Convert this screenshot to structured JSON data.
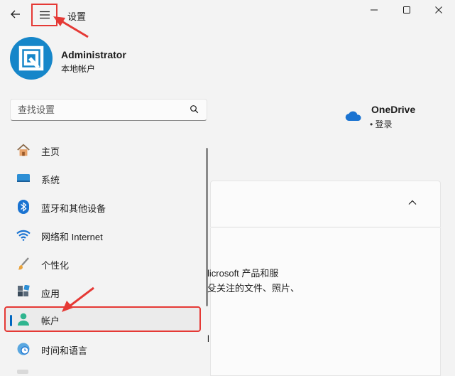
{
  "titlebar": {
    "app_title": "设置",
    "back_icon": "back-arrow-icon",
    "menu_icon": "hamburger-menu-icon",
    "window_controls": [
      "minimize-icon",
      "maximize-icon",
      "close-icon"
    ]
  },
  "user": {
    "name": "Administrator",
    "account_type": "本地帐户"
  },
  "search": {
    "placeholder": "查找设置"
  },
  "nav": {
    "items": [
      {
        "label": "主页",
        "icon": "home-icon"
      },
      {
        "label": "系统",
        "icon": "display-icon"
      },
      {
        "label": "蓝牙和其他设备",
        "icon": "bluetooth-icon"
      },
      {
        "label": "网络和 Internet",
        "icon": "wifi-icon"
      },
      {
        "label": "个性化",
        "icon": "paintbrush-icon"
      },
      {
        "label": "应用",
        "icon": "apps-icon"
      },
      {
        "label": "帐户",
        "icon": "account-icon",
        "selected": true
      },
      {
        "label": "时间和语言",
        "icon": "clock-globe-icon"
      }
    ]
  },
  "onedrive": {
    "title": "OneDrive",
    "status": "• 登录"
  },
  "content": {
    "line1": "licrosoft 产品和服",
    "line2": "殳关注的文件、照片、",
    "fragment": "l"
  },
  "colors": {
    "accent": "#0067c0",
    "highlight_box": "#e53935"
  }
}
